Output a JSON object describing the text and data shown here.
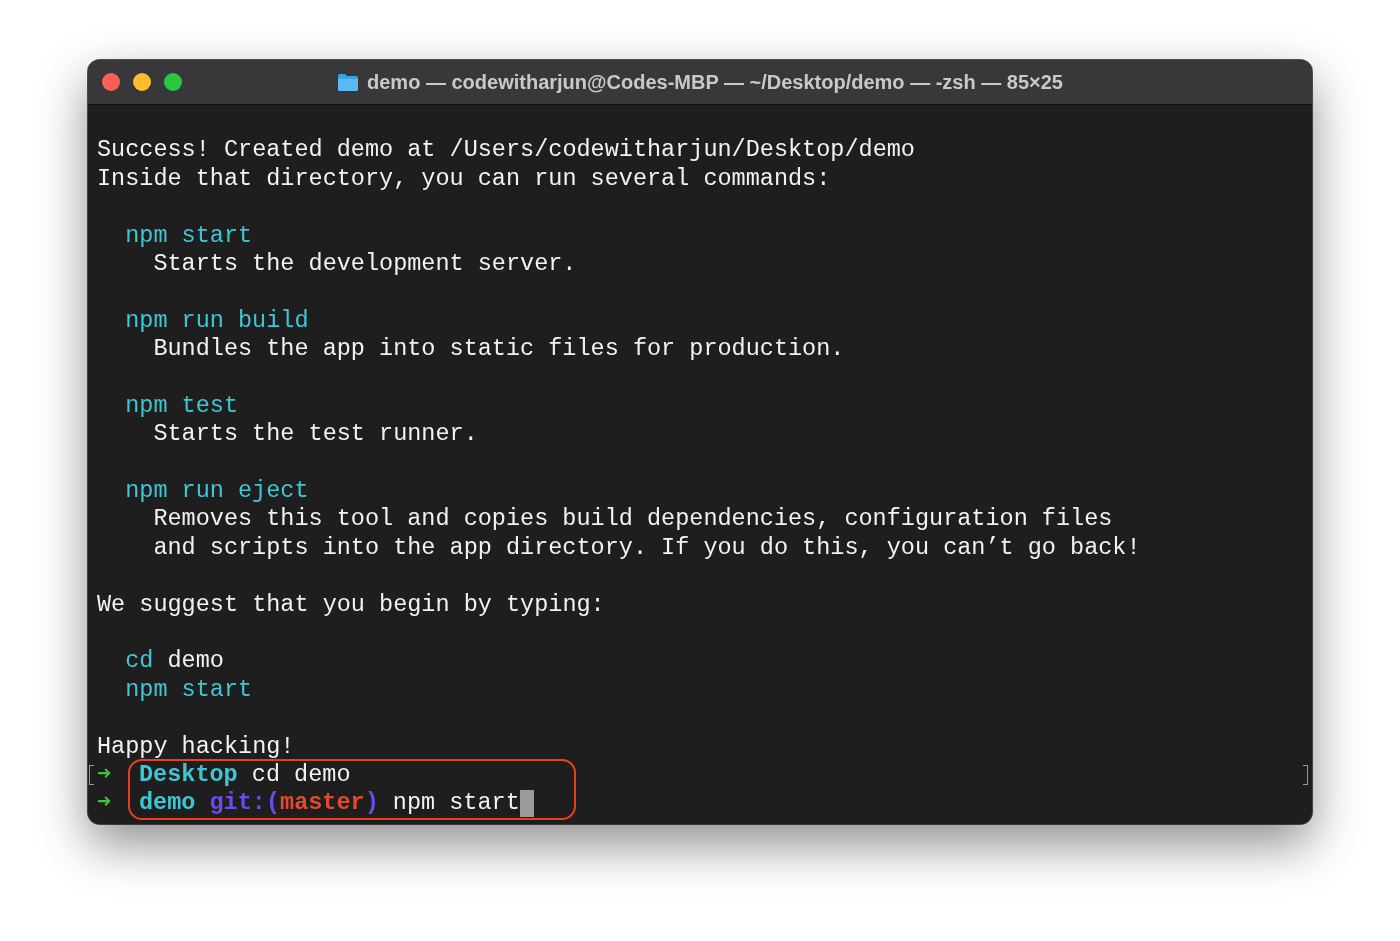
{
  "window": {
    "title": "demo — codewitharjun@Codes-MBP — ~/Desktop/demo — -zsh — 85×25"
  },
  "lines": [
    {
      "kind": "blank"
    },
    {
      "kind": "text",
      "segments": [
        {
          "kind": "plain",
          "text": "Success! Created demo at /Users/codewitharjun/Desktop/demo"
        }
      ]
    },
    {
      "kind": "text",
      "segments": [
        {
          "kind": "plain",
          "text": "Inside that directory, you can run several commands:"
        }
      ]
    },
    {
      "kind": "blank"
    },
    {
      "kind": "command",
      "segments": [
        {
          "kind": "command",
          "text": "npm start"
        }
      ]
    },
    {
      "kind": "description",
      "segments": [
        {
          "kind": "plain",
          "text": "Starts the development server."
        }
      ]
    },
    {
      "kind": "blank"
    },
    {
      "kind": "command",
      "segments": [
        {
          "kind": "command",
          "text": "npm run build"
        }
      ]
    },
    {
      "kind": "description",
      "segments": [
        {
          "kind": "plain",
          "text": "Bundles the app into static files for production."
        }
      ]
    },
    {
      "kind": "blank"
    },
    {
      "kind": "command",
      "segments": [
        {
          "kind": "command",
          "text": "npm test"
        }
      ]
    },
    {
      "kind": "description",
      "segments": [
        {
          "kind": "plain",
          "text": "Starts the test runner."
        }
      ]
    },
    {
      "kind": "blank"
    },
    {
      "kind": "command",
      "segments": [
        {
          "kind": "command",
          "text": "npm run eject"
        }
      ]
    },
    {
      "kind": "description",
      "segments": [
        {
          "kind": "plain",
          "text": "Removes this tool and copies build dependencies, configuration files"
        }
      ]
    },
    {
      "kind": "description",
      "segments": [
        {
          "kind": "plain",
          "text": "and scripts into the app directory. If you do this, you can’t go back!"
        }
      ]
    },
    {
      "kind": "blank"
    },
    {
      "kind": "text",
      "segments": [
        {
          "kind": "plain",
          "text": "We suggest that you begin by typing:"
        }
      ]
    },
    {
      "kind": "blank"
    },
    {
      "kind": "command",
      "segments": [
        {
          "kind": "command",
          "text": "cd"
        },
        {
          "kind": "plain",
          "text": "demo"
        }
      ]
    },
    {
      "kind": "command",
      "segments": [
        {
          "kind": "command",
          "text": "npm start"
        }
      ]
    },
    {
      "kind": "blank"
    },
    {
      "kind": "text",
      "segments": [
        {
          "kind": "plain",
          "text": "Happy hacking!"
        }
      ]
    },
    {
      "kind": "prompt",
      "arrow": "➜",
      "highlighted": true,
      "marked": true,
      "cursor": false,
      "segments": [
        {
          "kind": "dir",
          "text": "Desktop"
        },
        {
          "kind": "plain",
          "text": "cd demo"
        }
      ]
    },
    {
      "kind": "prompt",
      "arrow": "➜",
      "highlighted": true,
      "marked": false,
      "cursor": true,
      "segments": [
        {
          "kind": "dir",
          "text": "demo"
        },
        {
          "kind": "git",
          "text": "git:("
        },
        {
          "kind": "branch",
          "text": "master",
          "tight": true
        },
        {
          "kind": "git",
          "text": ")",
          "tight": true
        },
        {
          "kind": "plain",
          "text": "npm start"
        }
      ]
    }
  ]
}
